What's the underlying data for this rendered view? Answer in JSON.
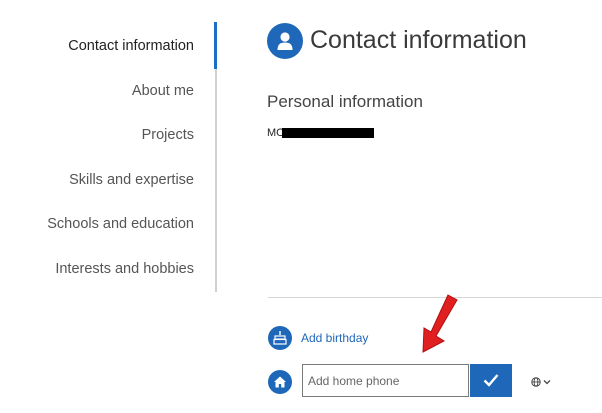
{
  "sidebar": {
    "items": [
      {
        "label": "Contact information",
        "active": true
      },
      {
        "label": "About me",
        "active": false
      },
      {
        "label": "Projects",
        "active": false
      },
      {
        "label": "Skills and expertise",
        "active": false
      },
      {
        "label": "Schools and education",
        "active": false
      },
      {
        "label": "Interests and hobbies",
        "active": false
      }
    ]
  },
  "header": {
    "title": "Contact information",
    "icon": "person-icon"
  },
  "personal": {
    "section_title": "Personal information",
    "name_visible_prefix": "MO"
  },
  "actions": {
    "add_birthday_label": "Add birthday",
    "birthday_icon": "cake-icon",
    "home_icon": "home-icon"
  },
  "phone_input": {
    "placeholder": "Add home phone",
    "value": ""
  },
  "confirm_icon": "checkmark-icon",
  "visibility_icon": "globe-icon",
  "annotation": {
    "arrow_color": "#e02020"
  },
  "colors": {
    "accent": "#1f67b8",
    "active_bar": "#1a6fc4"
  }
}
